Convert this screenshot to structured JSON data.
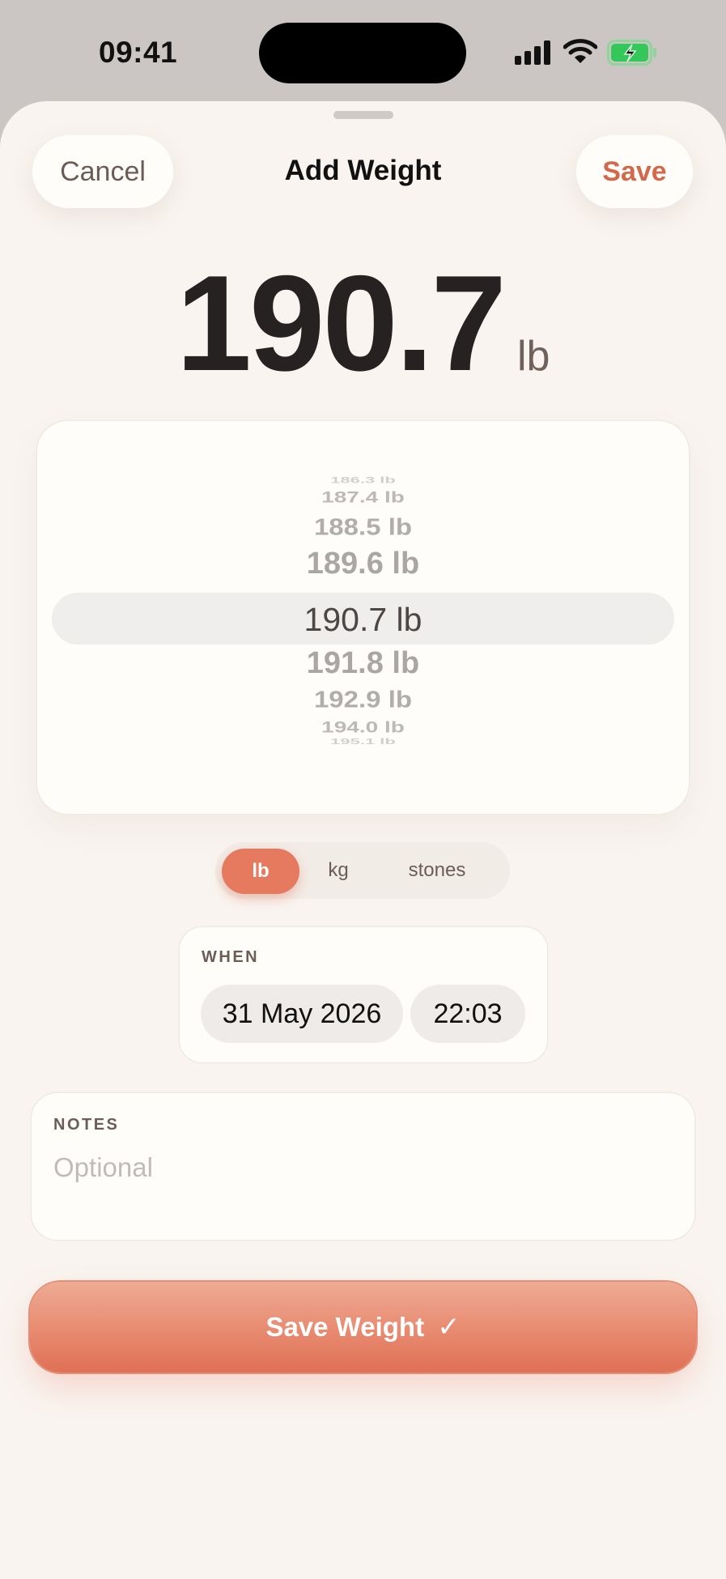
{
  "status_bar": {
    "time": "09:41",
    "icons": [
      "cellular-signal-icon",
      "wifi-icon",
      "battery-charging-icon"
    ],
    "battery_color": "#34c759"
  },
  "header": {
    "cancel_label": "Cancel",
    "title": "Add Weight",
    "save_label": "Save"
  },
  "weight": {
    "value": "190.7",
    "unit": "lb"
  },
  "picker": {
    "items": [
      "186.3 lb",
      "187.4 lb",
      "188.5 lb",
      "189.6 lb",
      "190.7 lb",
      "191.8 lb",
      "192.9 lb",
      "194.0 lb",
      "195.1 lb"
    ],
    "selected": "190.7 lb"
  },
  "units": {
    "options": [
      "lb",
      "kg",
      "stones"
    ],
    "selected": "lb"
  },
  "when": {
    "label": "WHEN",
    "date": "31 May 2026",
    "time": "22:03"
  },
  "notes": {
    "label": "NOTES",
    "placeholder": "Optional",
    "value": ""
  },
  "save_weight": {
    "label": "Save Weight",
    "icon": "checkmark-icon",
    "glyph": "✓"
  },
  "colors": {
    "accent": "#e57a5f",
    "save_text": "#d2694b",
    "sheet_background": "#f9f4ef"
  }
}
